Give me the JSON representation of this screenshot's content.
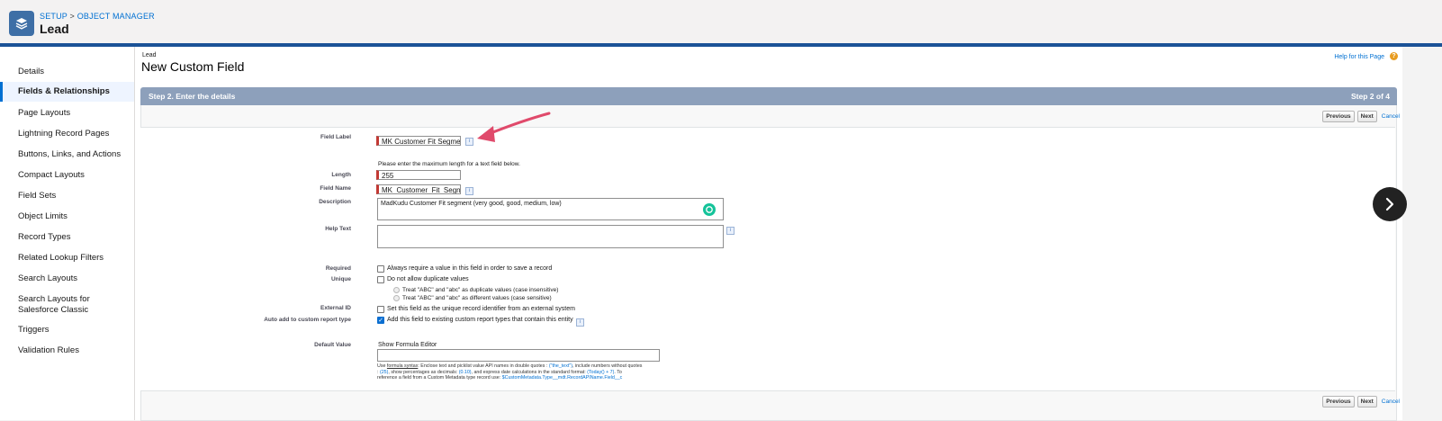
{
  "header": {
    "breadcrumb_setup": "SETUP",
    "breadcrumb_sep": ">",
    "breadcrumb_object": "OBJECT MANAGER",
    "title": "Lead",
    "app_icon": "layers-icon"
  },
  "sidebar": {
    "items": [
      {
        "label": "Details"
      },
      {
        "label": "Fields & Relationships"
      },
      {
        "label": "Page Layouts"
      },
      {
        "label": "Lightning Record Pages"
      },
      {
        "label": "Buttons, Links, and Actions"
      },
      {
        "label": "Compact Layouts"
      },
      {
        "label": "Field Sets"
      },
      {
        "label": "Object Limits"
      },
      {
        "label": "Record Types"
      },
      {
        "label": "Related Lookup Filters"
      },
      {
        "label": "Search Layouts"
      },
      {
        "label": "Search Layouts for Salesforce Classic"
      },
      {
        "label": "Triggers"
      },
      {
        "label": "Validation Rules"
      }
    ],
    "active": "Fields & Relationships"
  },
  "page": {
    "object_label": "Lead",
    "heading": "New Custom Field",
    "help_link": "Help for this Page",
    "help_icon": "?"
  },
  "step": {
    "title": "Step 2. Enter the details",
    "counter": "Step 2 of 4",
    "previous_label": "Previous",
    "next_label": "Next",
    "cancel_label": "Cancel"
  },
  "form": {
    "field_label_label": "Field Label",
    "field_label_value": "MK Customer Fit Segme",
    "length_note": "Please enter the maximum length for a text field below.",
    "length_label": "Length",
    "length_value": "255",
    "field_name_label": "Field Name",
    "field_name_value": "MK_Customer_Fit_Segn",
    "description_label": "Description",
    "description_value": "MadKudu Customer Fit segment (very good, good, medium, low)",
    "help_text_label": "Help Text",
    "help_text_value": "",
    "required_label": "Required",
    "required_text": "Always require a value in this field in order to save a record",
    "required_checked": false,
    "unique_label": "Unique",
    "unique_text": "Do not allow duplicate values",
    "unique_checked": false,
    "unique_option1": "Treat \"ABC\" and \"abc\" as duplicate values (case insensitive)",
    "unique_option2": "Treat \"ABC\" and \"abc\" as different values (case sensitive)",
    "external_id_label": "External ID",
    "external_id_text": "Set this field as the unique record identifier from an external system",
    "external_id_checked": false,
    "auto_add_label": "Auto add to custom report type",
    "auto_add_text": "Add this field to existing custom report types that contain this entity",
    "auto_add_checked": true,
    "default_value_label": "Default Value",
    "formula_editor_link": "Show Formula Editor",
    "default_value_value": "",
    "help_line1_a": "Use ",
    "help_line1_link": "formula syntax",
    "help_line1_b": ": Enclose text and picklist value API names in double quotes : ",
    "help_line1_ex": "(\"the_text\")",
    "help_line1_c": ", include numbers without quotes",
    "help_line2_a": ": ",
    "help_line2_ex1": "(25)",
    "help_line2_b": ", show percentages as decimals: ",
    "help_line2_ex2": "(0.10)",
    "help_line2_c": ", and express date calculations in the standard format: ",
    "help_line2_ex3": "(Today() + 7)",
    "help_line2_d": ". To",
    "help_line3_a": "reference a field from a Custom Metadata type record use: ",
    "help_line3_ex": "$CustomMetadata.Type__mdt.RecordAPIName.Field__c"
  },
  "colors": {
    "brand_blue": "#1b5297",
    "link": "#0070d2",
    "step_bar": "#8da0bb",
    "required_marker": "#c23934",
    "annotation_arrow": "#e04a6b"
  }
}
